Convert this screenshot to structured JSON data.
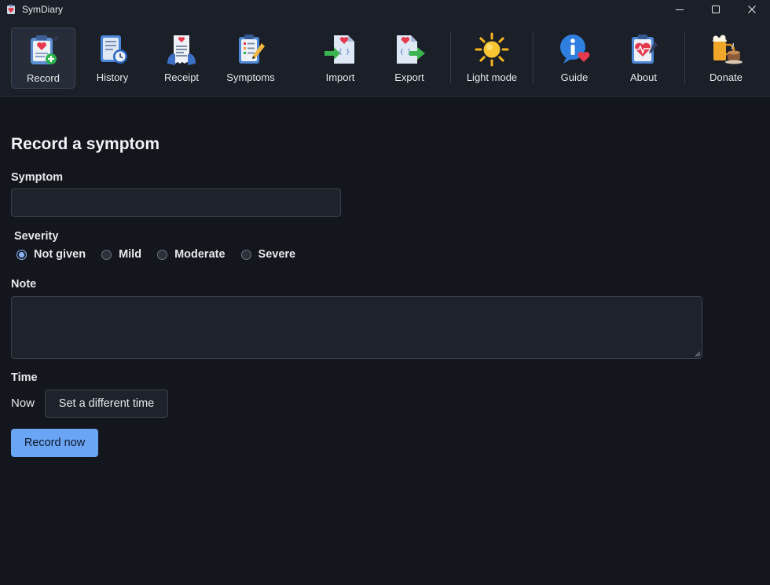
{
  "window": {
    "title": "SymDiary",
    "controls": [
      "minimize-icon",
      "maximize-icon",
      "close-icon"
    ]
  },
  "toolbar": {
    "items": [
      {
        "label": "Record",
        "icon": "record-clipboard-icon",
        "active": true
      },
      {
        "label": "History",
        "icon": "history-clock-icon",
        "active": false
      },
      {
        "label": "Receipt",
        "icon": "receipt-icon",
        "active": false
      },
      {
        "label": "Symptoms",
        "icon": "symptoms-list-icon",
        "active": false
      },
      {
        "label": "Import",
        "icon": "import-file-icon",
        "active": false
      },
      {
        "label": "Export",
        "icon": "export-file-icon",
        "active": false
      },
      {
        "label": "Light mode",
        "icon": "sun-icon",
        "active": false
      },
      {
        "label": "Guide",
        "icon": "info-heart-icon",
        "active": false
      },
      {
        "label": "About",
        "icon": "heart-clipboard-icon",
        "active": false
      },
      {
        "label": "Donate",
        "icon": "beer-coffee-icon",
        "active": false
      }
    ]
  },
  "form": {
    "title": "Record a symptom",
    "symptom_label": "Symptom",
    "symptom_value": "",
    "severity_label": "Severity",
    "severity_options": [
      "Not given",
      "Mild",
      "Moderate",
      "Severe"
    ],
    "severity_selected": "Not given",
    "note_label": "Note",
    "note_value": "",
    "time_label": "Time",
    "time_value": "Now",
    "set_time_button": "Set a different time",
    "record_button": "Record now"
  },
  "colors": {
    "background": "#13161c",
    "toolbar": "#1b1f28",
    "accent": "#6aa4f4",
    "input_bg": "#1e222a"
  }
}
